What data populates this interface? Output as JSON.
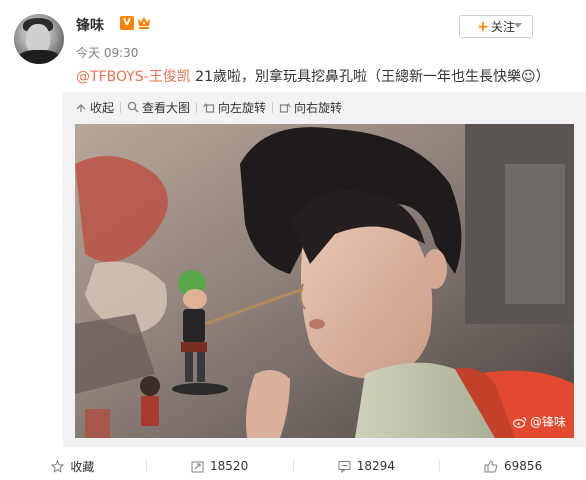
{
  "header": {
    "username": "锋味",
    "verified_badge": "V",
    "timestamp": "今天 09:30",
    "follow_label": "关注",
    "follow_prefix": "+"
  },
  "post": {
    "mention": "@TFBOYS-王俊凯",
    "text": " 21歲啦，別拿玩具挖鼻孔啦（王總新一年也生長快樂☺）"
  },
  "media_toolbar": {
    "collapse_label": "收起",
    "view_large_label": "查看大图",
    "rotate_left_label": "向左旋转",
    "rotate_right_label": "向右旋转"
  },
  "photo": {
    "watermark": "@锋味",
    "description_icon": "photo-image"
  },
  "footer": {
    "favorite_label": "收藏",
    "repost_count": "18520",
    "comment_count": "18294",
    "like_count": "69856"
  },
  "colors": {
    "accent_orange": "#ff8200",
    "mention_color": "#eb7350",
    "text": "#333333",
    "muted": "#808080"
  }
}
